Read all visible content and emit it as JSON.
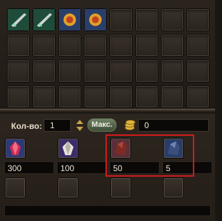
{
  "trade": {
    "qty_label": "Кол-во:",
    "qty_value": "1",
    "max_label": "Макс.",
    "money_value": "0"
  },
  "offers": [
    {
      "item": "red-crystal-icon",
      "value": "300"
    },
    {
      "item": "white-crystal-icon",
      "value": "100"
    },
    {
      "item": "dark-red-ore-icon",
      "value": "50"
    },
    {
      "item": "dark-blue-ore-icon",
      "value": "5"
    }
  ],
  "inventory_items": [
    "rifle-icon",
    "rifle-icon",
    "sun-emblem-icon",
    "sun-emblem-icon"
  ],
  "colors": {
    "highlight": "#d41a1a",
    "accent_gold": "#c9a54a"
  }
}
